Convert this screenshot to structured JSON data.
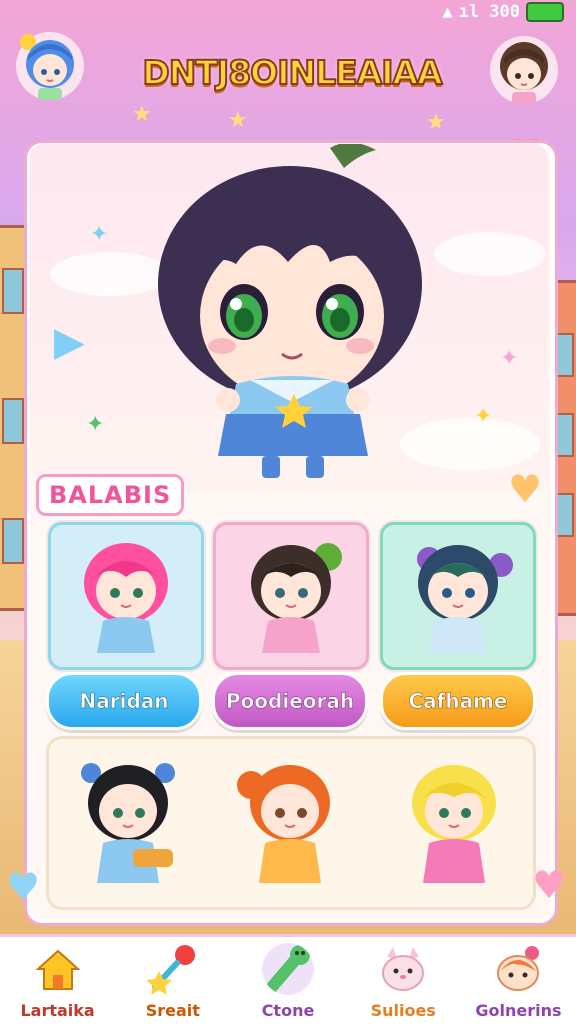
{
  "status_bar": {
    "signal_text": "ıl 300"
  },
  "header": {
    "title": "DNTJ8OINLEAIAA"
  },
  "section": {
    "label": "BALABIS"
  },
  "hero": {
    "character": "featured character portrait"
  },
  "category_buttons": [
    {
      "label": "Naridan",
      "color": "#2aa8ec"
    },
    {
      "label": "Poodieorah",
      "color": "#c158c4"
    },
    {
      "label": "Cafhame",
      "color": "#f59b1a"
    }
  ],
  "nav": {
    "items": [
      {
        "label": "Lartaika",
        "icon": "home-icon",
        "color": "#c0392b"
      },
      {
        "label": "Sreait",
        "icon": "star-wand-icon",
        "color": "#d35400"
      },
      {
        "label": "Ctone",
        "icon": "slime-icon",
        "color": "#8e44ad"
      },
      {
        "label": "Sulioes",
        "icon": "pet-icon",
        "color": "#e67e22"
      },
      {
        "label": "Golnerins",
        "icon": "mascot-icon",
        "color": "#8e44ad"
      }
    ],
    "active_index": 2
  },
  "colors": {
    "accent": "#f0559c",
    "title_fill": "#ffd23c",
    "title_outline": "#8a3a1d"
  }
}
